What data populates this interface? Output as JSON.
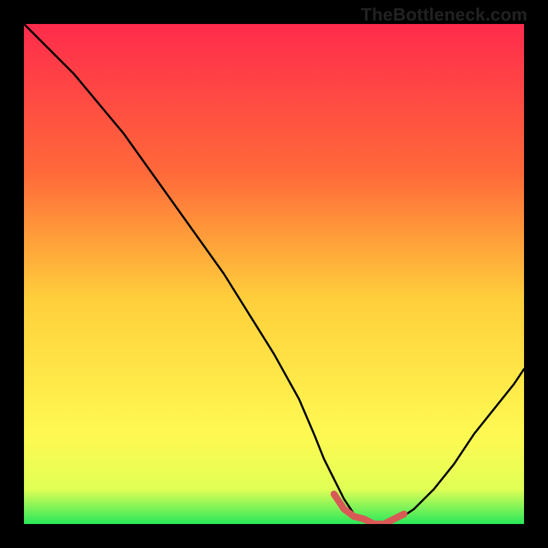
{
  "watermark": "TheBottleneck.com",
  "colors": {
    "gradient_top": "#ff2b4c",
    "gradient_mid1": "#ff6a3a",
    "gradient_mid2": "#ffcf3b",
    "gradient_mid3": "#fff952",
    "gradient_mid4": "#e1ff55",
    "gradient_bottom": "#29e85a",
    "curve": "#000000",
    "marker": "#d85a56",
    "frame": "#000000"
  },
  "chart_data": {
    "type": "line",
    "title": "",
    "xlabel": "",
    "ylabel": "",
    "xlim": [
      0,
      100
    ],
    "ylim": [
      0,
      100
    ],
    "series": [
      {
        "name": "bottleneck-curve",
        "x": [
          0,
          3,
          6,
          10,
          15,
          20,
          25,
          30,
          35,
          40,
          45,
          50,
          55,
          58,
          60,
          62,
          64,
          66,
          68,
          70,
          72,
          75,
          78,
          82,
          86,
          90,
          94,
          98,
          100
        ],
        "values": [
          100,
          97,
          94,
          90,
          84,
          78,
          71,
          64,
          57,
          50,
          42,
          34,
          25,
          18,
          13,
          9,
          5,
          2,
          1,
          0,
          0,
          1,
          3,
          7,
          12,
          18,
          23,
          28,
          31
        ]
      }
    ],
    "marker_segment": {
      "name": "optimal-range",
      "x": [
        62,
        64,
        66,
        68,
        70,
        72,
        74,
        76
      ],
      "values": [
        6,
        3,
        1.5,
        1,
        0,
        0,
        1,
        2
      ]
    }
  }
}
